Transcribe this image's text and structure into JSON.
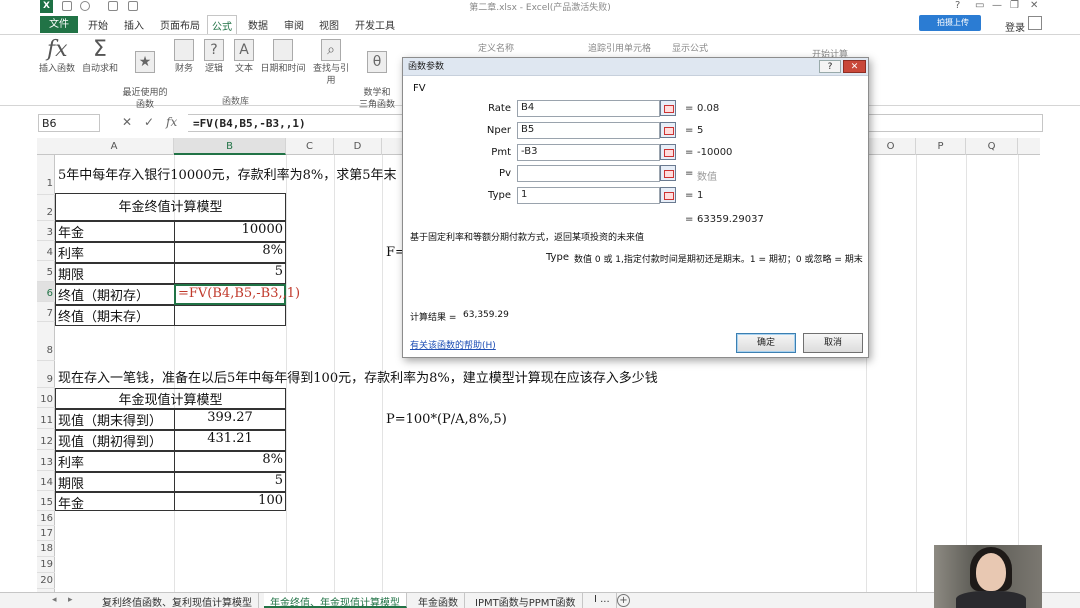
{
  "window": {
    "title": "第二章.xlsx - Excel(产品激活失败)",
    "controls": [
      "?",
      "▭",
      "—",
      "❐",
      "✕"
    ]
  },
  "ribbon": {
    "file_label": "文件",
    "tabs": [
      "开始",
      "插入",
      "页面布局",
      "公式",
      "数据",
      "审阅",
      "视图",
      "开发工具"
    ],
    "active_tab": "公式",
    "cloud_label": "拍摄上传",
    "login_label": "登录",
    "buttons": {
      "insert_function": "插入函数",
      "autosum": "自动求和",
      "recent": "最近使用的\n函数",
      "financial": "财务",
      "logical": "逻辑",
      "text": "文本",
      "datetime": "日期和时间",
      "lookup": "查找与引用",
      "math": "数学和\n三角函数",
      "define_name": "定义名称",
      "trace": "追踪引用单元格",
      "show_formulas": "显示公式",
      "calc": "开始计算"
    },
    "group_label": "函数库"
  },
  "formula_bar": {
    "name_box": "B6",
    "cancel": "✕",
    "enter": "✓",
    "fx": "fx",
    "formula": "=FV(B4,B5,-B3,,1)"
  },
  "columns": [
    "A",
    "B",
    "C",
    "D",
    "",
    "",
    "",
    "",
    "",
    "",
    "",
    "",
    "",
    "",
    "O",
    "P",
    "Q"
  ],
  "rows": [
    "1",
    "2",
    "3",
    "4",
    "5",
    "6",
    "7",
    "8",
    "9",
    "10",
    "11",
    "12",
    "13",
    "14",
    "15",
    "16",
    "17",
    "18",
    "19",
    "20"
  ],
  "sheet": {
    "r1_text": "5年中每年存入银行10000元，存款利率为8%，求第5年末",
    "t1_title": "年金终值计算模型",
    "t1_rows": [
      {
        "label": "年金",
        "value": "10000"
      },
      {
        "label": "利率",
        "value": "8%"
      },
      {
        "label": "期限",
        "value": "5"
      },
      {
        "label": "终值（期初存）",
        "value": "=FV(B4,B5,-B3,,1)"
      },
      {
        "label": "终值（期末存）",
        "value": ""
      }
    ],
    "d4_text": "F=",
    "r9_text": "现在存入一笔钱，准备在以后5年中每年得到100元，存款利率为8%，建立模型计算现在应该存入多少钱",
    "t2_title": "年金现值计算模型",
    "t2_rows": [
      {
        "label": "现值（期末得到）",
        "value": "399.27"
      },
      {
        "label": "现值（期初得到）",
        "value": "431.21"
      },
      {
        "label": "利率",
        "value": "8%"
      },
      {
        "label": "期限",
        "value": "5"
      },
      {
        "label": "年金",
        "value": "100"
      }
    ],
    "d11_text": "P=100*(P/A,8%,5)"
  },
  "dialog": {
    "title": "函数参数",
    "help_btn": "?",
    "close_btn": "✕",
    "function_name": "FV",
    "args": [
      {
        "label": "Rate",
        "input": "B4",
        "value": "0.08"
      },
      {
        "label": "Nper",
        "input": "B5",
        "value": "5"
      },
      {
        "label": "Pmt",
        "input": "-B3",
        "value": "-10000"
      },
      {
        "label": "Pv",
        "input": "",
        "value": "数值"
      },
      {
        "label": "Type",
        "input": "1",
        "value": "1"
      }
    ],
    "eq": "=",
    "result_value": "63359.29037",
    "description": "基于固定利率和等额分期付款方式，返回某项投资的未来值",
    "type_label": "Type",
    "type_desc": "数值 0 或 1,指定付款时间是期初还是期末。1 = 期初；0 或忽略 = 期末",
    "calc_result_label": "计算结果 =",
    "calc_result": "63,359.29",
    "help_link": "有关该函数的帮助(H)",
    "ok": "确定",
    "cancel": "取消"
  },
  "sheet_tabs": {
    "nav_prev": "◂",
    "nav_next": "▸",
    "tabs": [
      "复利终值函数、复利现值计算模型",
      "年金终值、年金现值计算模型",
      "年金函数",
      "IPMT函数与PPMT函数",
      "I ..."
    ],
    "active_index": 1,
    "add": "+"
  }
}
